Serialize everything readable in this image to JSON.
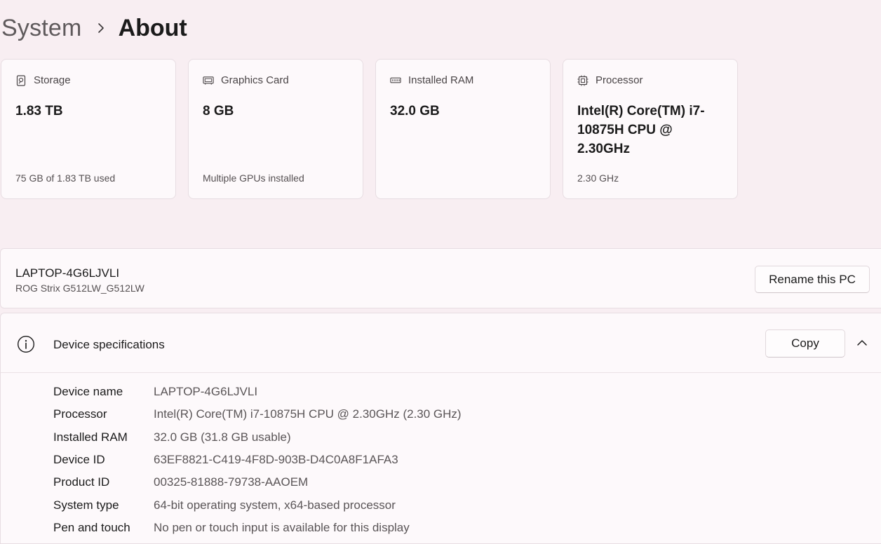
{
  "breadcrumb": {
    "parent": "System",
    "current": "About"
  },
  "cards": [
    {
      "icon": "storage-icon",
      "title": "Storage",
      "value": "1.83 TB",
      "footer": "75 GB of 1.83 TB used"
    },
    {
      "icon": "graphics-card-icon",
      "title": "Graphics Card",
      "value": "8 GB",
      "footer": "Multiple GPUs installed"
    },
    {
      "icon": "ram-icon",
      "title": "Installed RAM",
      "value": "32.0 GB",
      "footer": ""
    },
    {
      "icon": "processor-icon",
      "title": "Processor",
      "value": "Intel(R) Core(TM) i7-10875H CPU @ 2.30GHz",
      "footer": "2.30 GHz"
    }
  ],
  "pc": {
    "name": "LAPTOP-4G6LJVLI",
    "model": "ROG Strix G512LW_G512LW",
    "rename_label": "Rename this PC"
  },
  "specs": {
    "icon": "info-icon",
    "title": "Device specifications",
    "copy_label": "Copy",
    "expanded": true,
    "rows": [
      {
        "label": "Device name",
        "value": "LAPTOP-4G6LJVLI"
      },
      {
        "label": "Processor",
        "value": "Intel(R) Core(TM) i7-10875H CPU @ 2.30GHz (2.30 GHz)"
      },
      {
        "label": "Installed RAM",
        "value": "32.0 GB (31.8 GB usable)"
      },
      {
        "label": "Device ID",
        "value": "63EF8821-C419-4F8D-903B-D4C0A8F1AFA3"
      },
      {
        "label": "Product ID",
        "value": "00325-81888-79738-AAOEM"
      },
      {
        "label": "System type",
        "value": "64-bit operating system, x64-based processor"
      },
      {
        "label": "Pen and touch",
        "value": "No pen or touch input is available for this display"
      }
    ]
  }
}
